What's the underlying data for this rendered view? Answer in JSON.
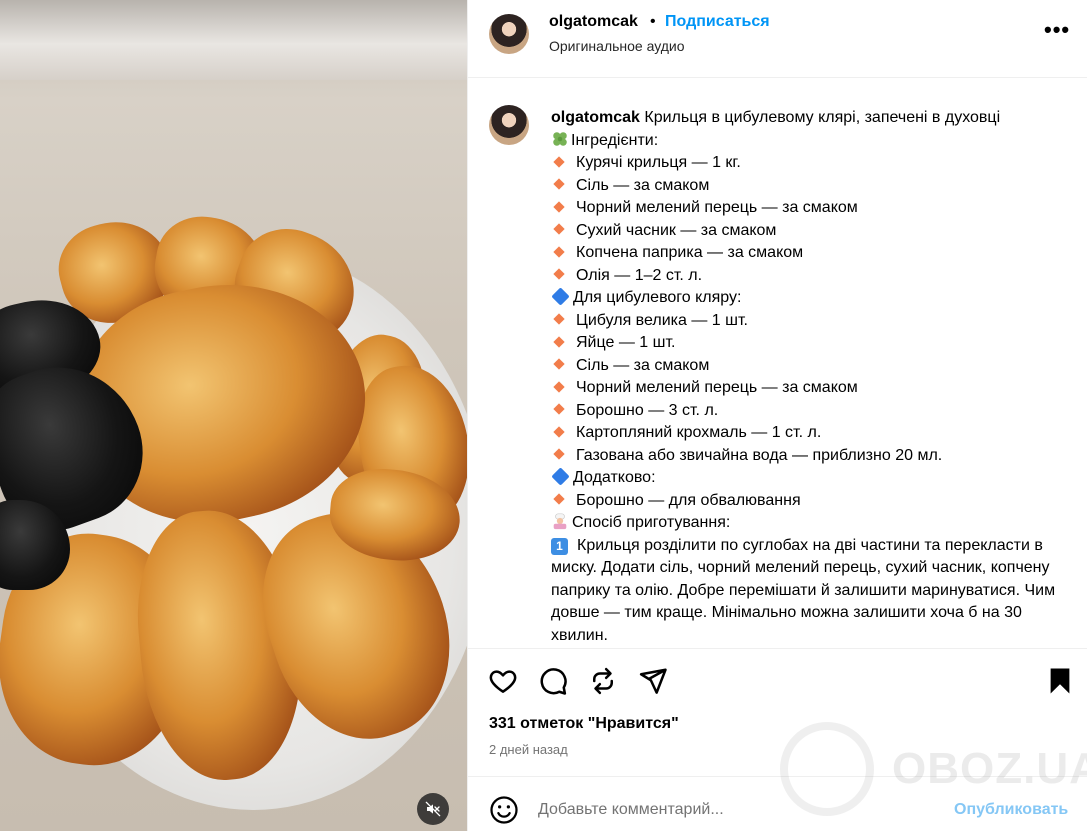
{
  "header": {
    "username": "olgatomcak",
    "separator": "•",
    "follow_label": "Подписаться",
    "audio": "Оригинальное аудио",
    "more_label": "•••"
  },
  "caption": {
    "username": "olgatomcak",
    "title": "Крильця в цибулевому клярі, запечені в духовці",
    "ingredients_heading": "Інгредієнти:",
    "ingredients": [
      "Курячі крильця — 1 кг.",
      "Сіль — за смаком",
      "Чорний мелений перець — за смаком",
      "Сухий часник — за смаком",
      "Копчена паприка — за смаком",
      "Олія — 1–2 ст. л."
    ],
    "batter_heading": "Для цибулевого кляру:",
    "batter": [
      "Цибуля велика — 1 шт.",
      "Яйце — 1 шт.",
      "Сіль — за смаком",
      "Чорний мелений перець — за смаком",
      "Борошно — 3 ст. л.",
      "Картопляний крохмаль — 1 ст. л.",
      "Газована або звичайна вода — приблизно 20 мл."
    ],
    "extra_heading": "Додатково:",
    "extra": [
      "Борошно — для обвалювання"
    ],
    "method_heading": "Спосіб приготування:",
    "step1_num": "1",
    "step1": "Крильця розділити по суглобах на дві частини та перекласти в миску. Додати сіль, чорний мелений перець, сухий часник, копчену паприку та олію. Добре перемішати й залишити маринуватися. Чим довше — тим краще. Мінімально можна залишити хоча б на 30 хвилин."
  },
  "stats": {
    "likes": "331 отметок \"Нравится\"",
    "posted": "2 дней назад"
  },
  "comment": {
    "placeholder": "Добавьте комментарий...",
    "publish_label": "Опубликовать"
  },
  "watermark": {
    "text": "OBOZ.UA"
  },
  "colors": {
    "link_blue": "#0095f6",
    "publish_disabled": "#85c7f5",
    "bullet_orange": "#f27d4a",
    "bullet_blue": "#2f7ce6",
    "muted_text": "#737373"
  },
  "icons": {
    "like": "heart-icon",
    "comment": "comment-icon",
    "repost": "repost-icon",
    "share": "send-icon",
    "save": "bookmark-icon",
    "emoji": "smiley-icon",
    "mute": "speaker-muted-icon",
    "more": "more-options-icon"
  }
}
